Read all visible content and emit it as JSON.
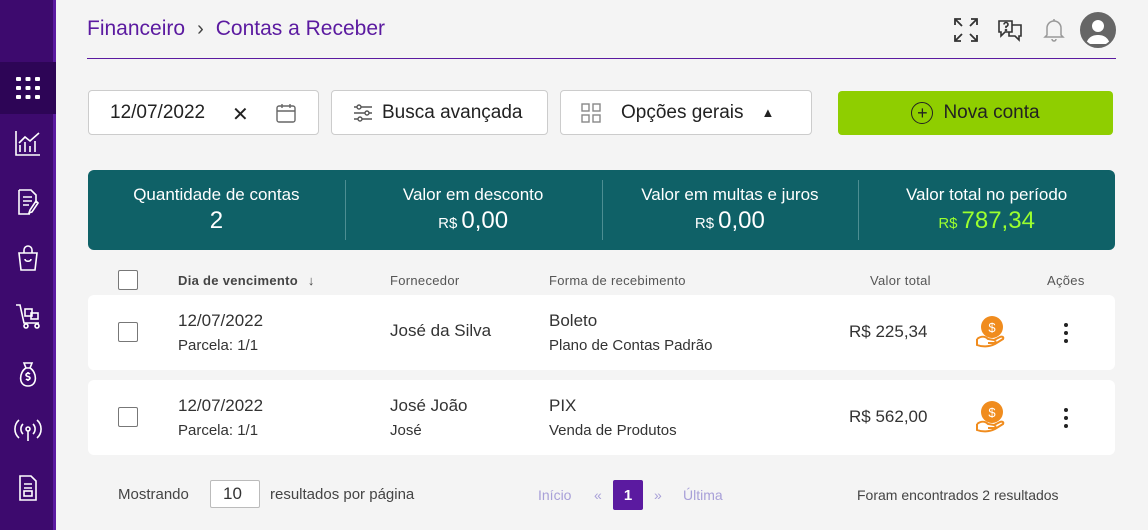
{
  "sidebar": {
    "items": [
      {
        "icon": "grid-icon"
      },
      {
        "icon": "chart-icon"
      },
      {
        "icon": "document-edit-icon"
      },
      {
        "icon": "shopping-bag-icon"
      },
      {
        "icon": "delivery-cart-icon"
      },
      {
        "icon": "money-bag-icon"
      },
      {
        "icon": "broadcast-icon"
      },
      {
        "icon": "report-icon"
      }
    ]
  },
  "header": {
    "breadcrumb": [
      "Financeiro",
      "Contas a Receber"
    ],
    "separator": "›"
  },
  "toolbar": {
    "date_value": "12/07/2022",
    "clear_symbol": "✕",
    "busca_label": "Busca avançada",
    "opcoes_label": "Opções gerais",
    "nova_label": "Nova conta"
  },
  "summary": {
    "quantidade_label": "Quantidade de contas",
    "quantidade_value": "2",
    "desconto_label": "Valor em desconto",
    "desconto_currency": "R$",
    "desconto_value": "0,00",
    "multas_label": "Valor em multas e juros",
    "multas_currency": "R$",
    "multas_value": "0,00",
    "total_label": "Valor total no período",
    "total_currency": "R$",
    "total_value": "787,34"
  },
  "table": {
    "headers": {
      "vencimento": "Dia de vencimento",
      "sort_arrow": "↓",
      "fornecedor": "Fornecedor",
      "forma": "Forma de recebimento",
      "valor": "Valor total",
      "acoes": "Ações"
    },
    "rows": [
      {
        "date": "12/07/2022",
        "parcela": "Parcela: 1/1",
        "fornecedor": "José da Silva",
        "fornecedor_sub": "",
        "forma": "Boleto",
        "plano": "Plano de Contas Padrão",
        "valor": "R$ 225,34"
      },
      {
        "date": "12/07/2022",
        "parcela": "Parcela: 1/1",
        "fornecedor": "José João",
        "fornecedor_sub": "José",
        "forma": "PIX",
        "plano": "Venda de Produtos",
        "valor": "R$ 562,00"
      }
    ]
  },
  "footer": {
    "mostrando": "Mostrando",
    "per_page": "10",
    "resultados_label": "resultados por página",
    "inicio": "Início",
    "prev": "«",
    "current_page": "1",
    "next": "»",
    "ultima": "Última",
    "found": "Foram encontrados 2 resultados"
  },
  "colors": {
    "brand_purple": "#5b1aa0",
    "sidebar": "#3d0a6e",
    "summary_bg": "#0f6167",
    "accent_green": "#8fce00",
    "total_green": "#9bff2e",
    "coin_orange": "#f08c1e"
  }
}
